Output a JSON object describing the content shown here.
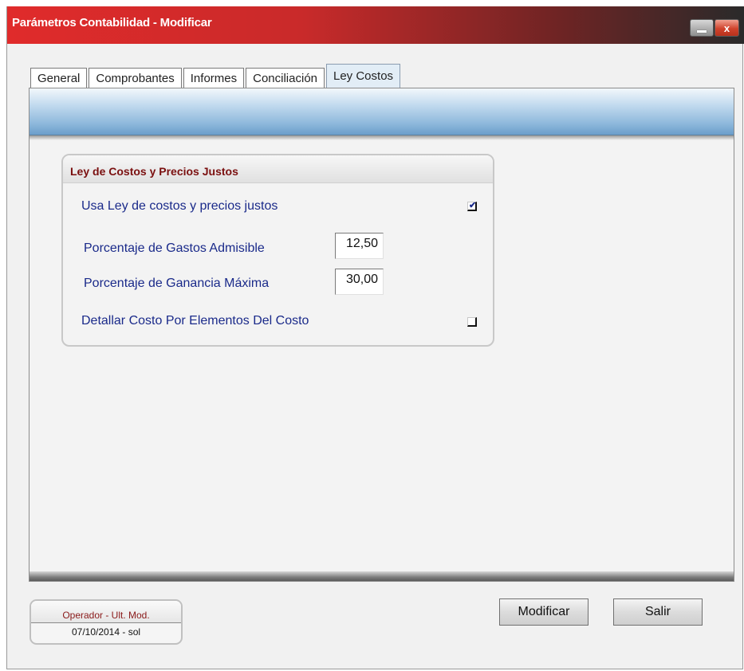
{
  "window": {
    "title": "Parámetros Contabilidad - Modificar",
    "close_label": "x"
  },
  "tabs": [
    {
      "label": "General",
      "active": false
    },
    {
      "label": "Comprobantes",
      "active": false
    },
    {
      "label": "Informes",
      "active": false
    },
    {
      "label": "Conciliación",
      "active": false
    },
    {
      "label": "Ley Costos",
      "active": true
    }
  ],
  "group": {
    "title": "Ley de Costos y Precios Justos",
    "usa_ley_label": "Usa Ley de costos y precios justos",
    "usa_ley_checked": true,
    "gastos_label": "Porcentaje de Gastos Admisible",
    "gastos_value": "12,50",
    "ganancia_label": "Porcentaje de Ganancia Máxima",
    "ganancia_value": "30,00",
    "detallar_label": "Detallar Costo Por Elementos Del Costo",
    "detallar_checked": false
  },
  "status": {
    "label": "Operador - Ult. Mod.",
    "value": "07/10/2014 - sol"
  },
  "buttons": {
    "modificar": "Modificar",
    "salir": "Salir"
  },
  "check_mark": "✔",
  "colors": {
    "title_bar_start": "#e02b2b",
    "label_text": "#1a2a8a",
    "group_title": "#7a0f0f"
  }
}
